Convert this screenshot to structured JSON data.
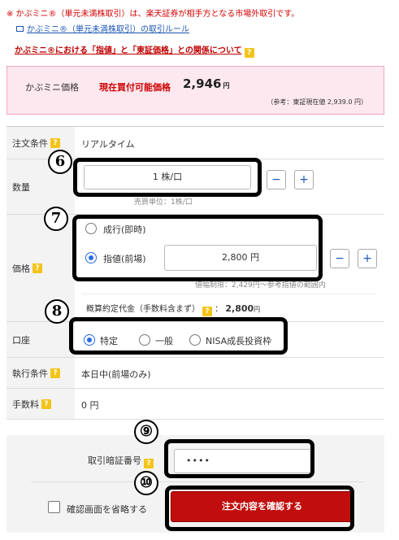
{
  "notice": {
    "text": "※ かぶミニ®（単元未満株取引）は、楽天証券が相手方となる市場外取引です。",
    "rule_link": "かぶミニ®（単元未満株取引）の取引ルール",
    "help_link": "かぶミニ®における「指値」と「東証価格」との関係について"
  },
  "price_box": {
    "label": "かぶミニ価格",
    "caption": "現在買付可能価格",
    "value": "2,946",
    "unit": "円",
    "reference": "（参考：東証現在値 2,939.0 円）"
  },
  "form": {
    "condition": {
      "label": "注文条件",
      "value": "リアルタイム"
    },
    "quantity": {
      "label": "数量",
      "value": "1 株/口",
      "minus": "−",
      "plus": "+",
      "unit_note": "売買単位：1株/口"
    },
    "price": {
      "label": "価格",
      "market_option": "成行(即時)",
      "limit_option": "指値(前場)",
      "limit_value": "2,800 円",
      "minus": "−",
      "plus": "+",
      "range_note": "値幅制限：2,429円～参考指値の範囲内",
      "estimate_label": "概算約定代金（手数料含まず）",
      "estimate_value": "2,800",
      "estimate_unit": "円"
    },
    "account": {
      "label": "口座",
      "options": [
        "特定",
        "一般",
        "NISA成長投資枠"
      ],
      "selected": "特定"
    },
    "execution": {
      "label": "執行条件",
      "value": "本日中(前場のみ)"
    },
    "fee": {
      "label": "手数料",
      "value": "0 円"
    }
  },
  "pin": {
    "label": "取引暗証番号",
    "value": "••••",
    "skip_label": "確認画面を省略する",
    "confirm_button": "注文内容を確認する"
  },
  "callouts": [
    "6",
    "7",
    "8",
    "⑨",
    "⑩"
  ],
  "help_badge": "?"
}
